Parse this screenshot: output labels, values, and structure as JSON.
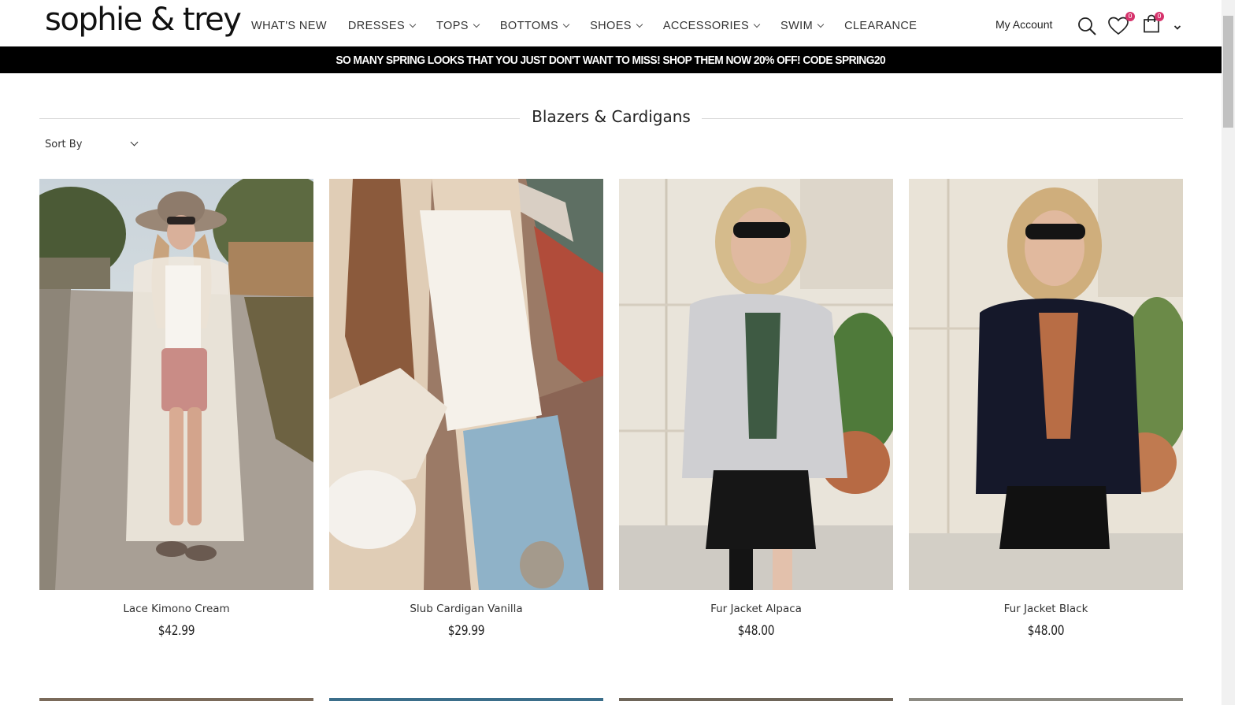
{
  "header": {
    "logo": "sophie & trey",
    "nav": [
      {
        "label": "WHAT'S NEW",
        "dropdown": false
      },
      {
        "label": "DRESSES",
        "dropdown": true
      },
      {
        "label": "TOPS",
        "dropdown": true
      },
      {
        "label": "BOTTOMS",
        "dropdown": true
      },
      {
        "label": "SHOES",
        "dropdown": true
      },
      {
        "label": "ACCESSORIES",
        "dropdown": true
      },
      {
        "label": "SWIM",
        "dropdown": true
      },
      {
        "label": "CLEARANCE",
        "dropdown": false
      }
    ],
    "account_label": "My Account",
    "wishlist_count": "0",
    "cart_count": "0",
    "icons": [
      "search-icon",
      "heart-icon",
      "shopping-bag-icon",
      "chevron-down-icon"
    ]
  },
  "promo": {
    "text": "SO MANY SPRING LOOKS THAT YOU JUST DON'T WANT TO MISS! SHOP THEM NOW 20% OFF! CODE SPRING20"
  },
  "page": {
    "title": "Blazers & Cardigans",
    "sort_label": "Sort By"
  },
  "products": [
    {
      "name": "Lace Kimono Cream",
      "price": "$42.99"
    },
    {
      "name": "Slub Cardigan Vanilla",
      "price": "$29.99"
    },
    {
      "name": "Fur Jacket Alpaca",
      "price": "$48.00"
    },
    {
      "name": "Fur Jacket Black",
      "price": "$48.00"
    }
  ],
  "colors": {
    "promo_bg": "#000000",
    "badge": "#d6336c",
    "text": "#222222"
  }
}
